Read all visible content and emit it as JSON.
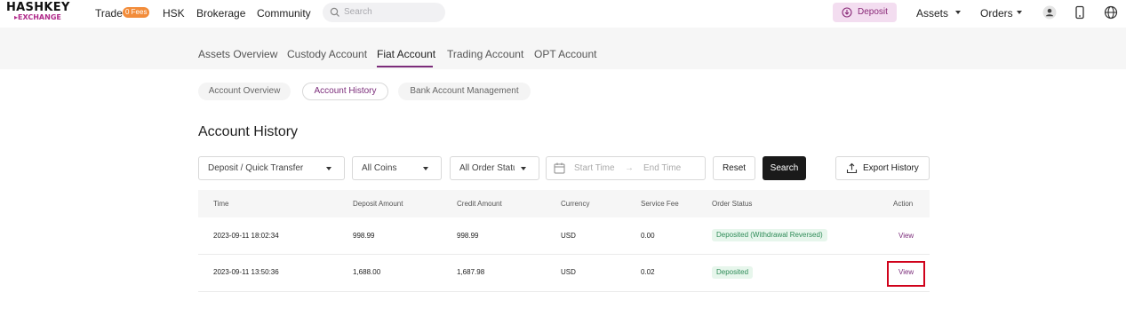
{
  "brand": {
    "name": "HASHKEY",
    "sub": "▸EXCHANGE"
  },
  "nav": {
    "trade": "Trade",
    "fees_badge": "0 Fees",
    "hsk": "HSK",
    "brokerage": "Brokerage",
    "community": "Community",
    "search_placeholder": "Search",
    "deposit": "Deposit",
    "assets": "Assets",
    "orders": "Orders"
  },
  "tabs": [
    "Assets Overview",
    "Custody Account",
    "Fiat Account",
    "Trading Account",
    "OPT Account"
  ],
  "subtabs": [
    "Account Overview",
    "Account History",
    "Bank Account Management"
  ],
  "page_title": "Account History",
  "filters": {
    "type": "Deposit / Quick Transfer",
    "coins": "All Coins",
    "order_status": "All Order Statu",
    "start_placeholder": "Start Time",
    "end_placeholder": "End Time",
    "arrow": "→",
    "reset": "Reset",
    "search": "Search",
    "export": "Export History"
  },
  "table": {
    "headers": [
      "Time",
      "Deposit Amount",
      "Credit Amount",
      "Currency",
      "Service Fee",
      "Order Status",
      "Action"
    ],
    "rows": [
      {
        "time": "2023-09-11 18:02:34",
        "deposit": "998.99",
        "credit": "998.99",
        "currency": "USD",
        "fee": "0.00",
        "status": "Deposited (Withdrawal Reversed)",
        "action": "View"
      },
      {
        "time": "2023-09-11 13:50:36",
        "deposit": "1,688.00",
        "credit": "1,687.98",
        "currency": "USD",
        "fee": "0.02",
        "status": "Deposited",
        "action": "View"
      }
    ]
  },
  "colors": {
    "accent": "#7b2c7a",
    "status_bg": "#e7f6ec",
    "status_text": "#2e8b57",
    "highlight": "#d0021b"
  }
}
